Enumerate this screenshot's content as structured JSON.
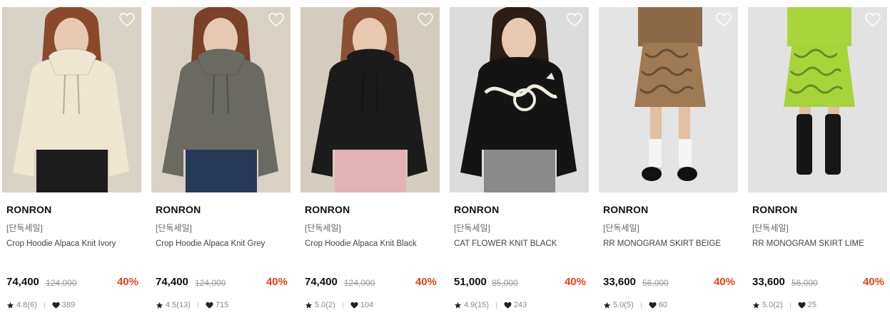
{
  "products": [
    {
      "brand": "RONRON",
      "tag": "[단독세일]",
      "name": "Crop Hoodie Alpaca Knit Ivory",
      "price": "74,400",
      "original_price": "124,000",
      "discount": "40%",
      "rating": "4.8(6)",
      "likes": "389",
      "bg": "#d9d2c6",
      "top_color": "#efe6d2",
      "bottom_color": "#1c1c1c",
      "hair": "#8a4a2a"
    },
    {
      "brand": "RONRON",
      "tag": "[단독세일]",
      "name": "Crop Hoodie Alpaca Knit Grey",
      "price": "74,400",
      "original_price": "124,000",
      "discount": "40%",
      "rating": "4.5(13)",
      "likes": "715",
      "bg": "#d8d1c4",
      "top_color": "#6a6a62",
      "bottom_color": "#283a5a",
      "hair": "#7a4028"
    },
    {
      "brand": "RONRON",
      "tag": "[단독세일]",
      "name": "Crop Hoodie Alpaca Knit Black",
      "price": "74,400",
      "original_price": "124,000",
      "discount": "40%",
      "rating": "5.0(2)",
      "likes": "104",
      "bg": "#d4ccbf",
      "top_color": "#1b1b1b",
      "bottom_color": "#e2b2b6",
      "hair": "#8a5232"
    },
    {
      "brand": "RONRON",
      "tag": "[단독세일]",
      "name": "CAT FLOWER KNIT BLACK",
      "price": "51,000",
      "original_price": "85,000",
      "discount": "40%",
      "rating": "4.9(15)",
      "likes": "243",
      "bg": "#dcdcdc",
      "top_color": "#141414",
      "bottom_color": "#8a8a8a",
      "hair": "#2b1c14"
    },
    {
      "brand": "RONRON",
      "tag": "[단독세일]",
      "name": "RR MONOGRAM SKIRT BEIGE",
      "price": "33,600",
      "original_price": "56,000",
      "discount": "40%",
      "rating": "5.0(5)",
      "likes": "60",
      "bg": "#e4e4e4",
      "top_color": "#8c6a48",
      "bottom_color": "#a07a52",
      "hair": "#2a2a2a"
    },
    {
      "brand": "RONRON",
      "tag": "[단독세일]",
      "name": "RR MONOGRAM SKIRT LIME",
      "price": "33,600",
      "original_price": "56,000",
      "discount": "40%",
      "rating": "5.0(2)",
      "likes": "25",
      "bg": "#e2e2e2",
      "top_color": "#a8d63c",
      "bottom_color": "#a6d43a",
      "hair": "#1a1a1a"
    }
  ],
  "icons": {
    "favorite": "heart-outline-icon",
    "rating": "star-icon",
    "likes": "heart-icon"
  },
  "colors": {
    "discount": "#e8401c",
    "strike": "#999999"
  }
}
